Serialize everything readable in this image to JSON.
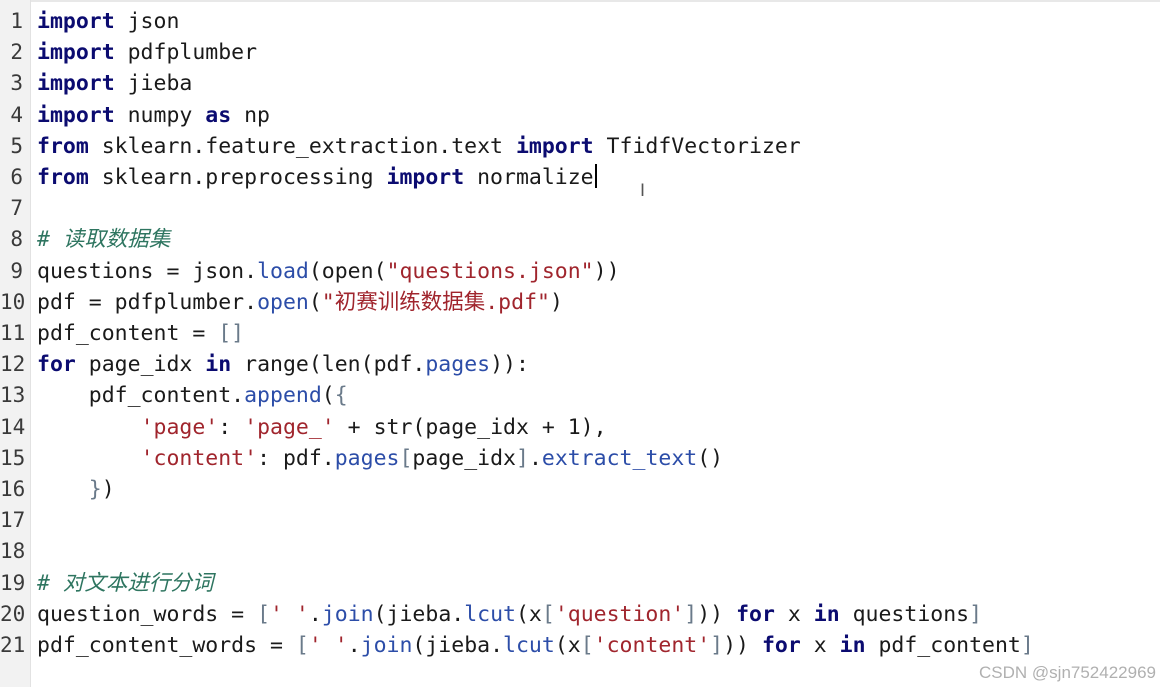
{
  "editor": {
    "lines": [
      {
        "n": "1",
        "tokens": [
          {
            "t": "import",
            "c": "kw"
          },
          {
            "t": " json"
          }
        ]
      },
      {
        "n": "2",
        "tokens": [
          {
            "t": "import",
            "c": "kw"
          },
          {
            "t": " pdfplumber"
          }
        ]
      },
      {
        "n": "3",
        "tokens": [
          {
            "t": "import",
            "c": "kw"
          },
          {
            "t": " jieba"
          }
        ]
      },
      {
        "n": "4",
        "tokens": [
          {
            "t": "import",
            "c": "kw"
          },
          {
            "t": " numpy "
          },
          {
            "t": "as",
            "c": "kw"
          },
          {
            "t": " np"
          }
        ]
      },
      {
        "n": "5",
        "tokens": [
          {
            "t": "from",
            "c": "kw"
          },
          {
            "t": " sklearn.feature_extraction.text "
          },
          {
            "t": "import",
            "c": "kw"
          },
          {
            "t": " TfidfVectorizer"
          }
        ]
      },
      {
        "n": "6",
        "tokens": [
          {
            "t": "from",
            "c": "kw"
          },
          {
            "t": " sklearn.preprocessing "
          },
          {
            "t": "import",
            "c": "kw"
          },
          {
            "t": " normalize"
          }
        ],
        "caret": true
      },
      {
        "n": "7",
        "tokens": []
      },
      {
        "n": "8",
        "tokens": [
          {
            "t": "# 读取数据集",
            "c": "cmt"
          }
        ]
      },
      {
        "n": "9",
        "tokens": [
          {
            "t": "questions = json."
          },
          {
            "t": "load",
            "c": "attr"
          },
          {
            "t": "(open("
          },
          {
            "t": "\"questions.json\"",
            "c": "str"
          },
          {
            "t": "))"
          }
        ]
      },
      {
        "n": "10",
        "tokens": [
          {
            "t": "pdf = pdfplumber."
          },
          {
            "t": "open",
            "c": "attr"
          },
          {
            "t": "("
          },
          {
            "t": "\"初赛训练数据集.pdf\"",
            "c": "str"
          },
          {
            "t": ")"
          }
        ]
      },
      {
        "n": "11",
        "tokens": [
          {
            "t": "pdf_content = "
          },
          {
            "t": "[]",
            "c": "br"
          }
        ]
      },
      {
        "n": "12",
        "tokens": [
          {
            "t": "for",
            "c": "kw"
          },
          {
            "t": " page_idx "
          },
          {
            "t": "in",
            "c": "kw"
          },
          {
            "t": " range(len(pdf."
          },
          {
            "t": "pages",
            "c": "attr"
          },
          {
            "t": ")):"
          }
        ]
      },
      {
        "n": "13",
        "tokens": [
          {
            "t": "    pdf_content."
          },
          {
            "t": "append",
            "c": "attr"
          },
          {
            "t": "("
          },
          {
            "t": "{",
            "c": "br"
          }
        ]
      },
      {
        "n": "14",
        "tokens": [
          {
            "t": "        "
          },
          {
            "t": "'page'",
            "c": "str"
          },
          {
            "t": ": "
          },
          {
            "t": "'page_'",
            "c": "str"
          },
          {
            "t": " + str(page_idx + 1),"
          }
        ]
      },
      {
        "n": "15",
        "tokens": [
          {
            "t": "        "
          },
          {
            "t": "'content'",
            "c": "str"
          },
          {
            "t": ": pdf."
          },
          {
            "t": "pages",
            "c": "attr"
          },
          {
            "t": "[",
            "c": "br"
          },
          {
            "t": "page_idx"
          },
          {
            "t": "]",
            "c": "br"
          },
          {
            "t": "."
          },
          {
            "t": "extract_text",
            "c": "attr"
          },
          {
            "t": "()"
          }
        ]
      },
      {
        "n": "16",
        "tokens": [
          {
            "t": "    "
          },
          {
            "t": "}",
            "c": "br"
          },
          {
            "t": ")"
          }
        ]
      },
      {
        "n": "17",
        "tokens": []
      },
      {
        "n": "18",
        "tokens": []
      },
      {
        "n": "19",
        "tokens": [
          {
            "t": "# 对文本进行分词",
            "c": "cmt"
          }
        ]
      },
      {
        "n": "20",
        "tokens": [
          {
            "t": "question_words = "
          },
          {
            "t": "[",
            "c": "br"
          },
          {
            "t": "' '",
            "c": "str"
          },
          {
            "t": "."
          },
          {
            "t": "join",
            "c": "attr"
          },
          {
            "t": "(jieba."
          },
          {
            "t": "lcut",
            "c": "attr"
          },
          {
            "t": "(x"
          },
          {
            "t": "[",
            "c": "br"
          },
          {
            "t": "'question'",
            "c": "str"
          },
          {
            "t": "]",
            "c": "br"
          },
          {
            "t": ")) "
          },
          {
            "t": "for",
            "c": "kw"
          },
          {
            "t": " x "
          },
          {
            "t": "in",
            "c": "kw"
          },
          {
            "t": " questions"
          },
          {
            "t": "]",
            "c": "br"
          }
        ]
      },
      {
        "n": "21",
        "tokens": [
          {
            "t": "pdf_content_words = "
          },
          {
            "t": "[",
            "c": "br"
          },
          {
            "t": "' '",
            "c": "str"
          },
          {
            "t": "."
          },
          {
            "t": "join",
            "c": "attr"
          },
          {
            "t": "(jieba."
          },
          {
            "t": "lcut",
            "c": "attr"
          },
          {
            "t": "(x"
          },
          {
            "t": "[",
            "c": "br"
          },
          {
            "t": "'content'",
            "c": "str"
          },
          {
            "t": "]",
            "c": "br"
          },
          {
            "t": ")) "
          },
          {
            "t": "for",
            "c": "kw"
          },
          {
            "t": " x "
          },
          {
            "t": "in",
            "c": "kw"
          },
          {
            "t": " pdf_content"
          },
          {
            "t": "]",
            "c": "br"
          }
        ]
      }
    ]
  },
  "watermark": "CSDN @sjn752422969",
  "icons": {
    "cursor": "text-cursor-icon"
  },
  "colors": {
    "keyword": "#0b0b70",
    "string": "#a0252d",
    "attribute": "#2c4da8",
    "comment": "#2e7560",
    "bracket": "#6a7a8a"
  }
}
